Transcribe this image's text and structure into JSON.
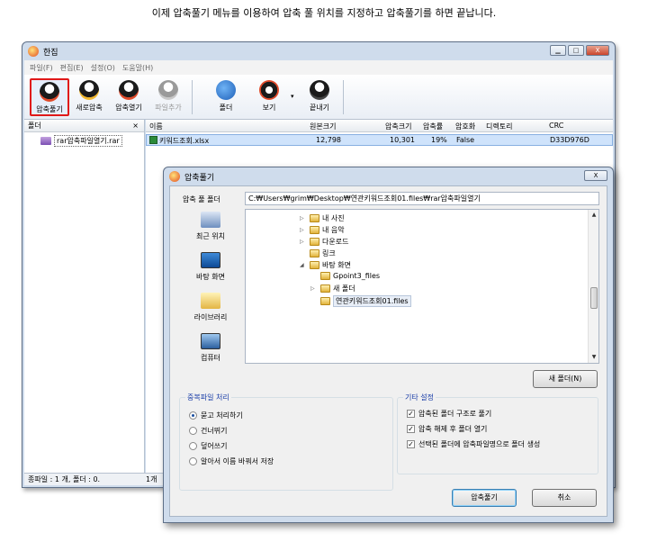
{
  "caption": "이제 압축풀기 메뉴를 이용하여  압축 풀 위치를 지정하고 압축풀기를 하면 끝납니다.",
  "main_window": {
    "title": "한집",
    "controls": {
      "minimize": "▁",
      "maximize": "□",
      "close": "X"
    },
    "menu": [
      "파일(F)",
      "편집(E)",
      "설정(O)",
      "도움말(H)"
    ],
    "toolbar": [
      {
        "label": "압축풀기",
        "icon": "penguin-extract-icon",
        "state": "selected"
      },
      {
        "label": "새로압축",
        "icon": "penguin-new-icon"
      },
      {
        "label": "압축열기",
        "icon": "penguin-open-icon"
      },
      {
        "label": "파일추가",
        "icon": "penguin-add-icon",
        "state": "disabled"
      },
      {
        "label": "폴더",
        "icon": "globe-folder-icon"
      },
      {
        "label": "보기",
        "icon": "eye-view-icon"
      },
      {
        "label": "끝내기",
        "icon": "exit-icon"
      }
    ],
    "left_pane": {
      "header": "폴더",
      "close": "×",
      "tree_item": "rar압축파일열기.rar"
    },
    "file_list": {
      "columns": [
        "이름",
        "원본크기",
        "압축크기",
        "압축률",
        "암호화",
        "디렉토리",
        "CRC"
      ],
      "rows": [
        {
          "name": "키워드조회.xlsx",
          "original_size": "12,798",
          "compressed_size": "10,301",
          "ratio": "19%",
          "encrypted": "False",
          "directory": "",
          "crc": "D33D976D"
        }
      ]
    },
    "status": {
      "left": "종파일 : 1 개, 폴더 : 0.",
      "right": "1개"
    }
  },
  "dialog": {
    "title": "압축풀기",
    "close": "X",
    "path_label": "압축 풀 폴더",
    "path_value": "C:₩Users₩grim₩Desktop₩연관키워드조회01.files₩rar압축파일열기",
    "places": [
      {
        "label": "최근 위치",
        "icon": "recent-places-icon"
      },
      {
        "label": "바탕 화면",
        "icon": "desktop-icon"
      },
      {
        "label": "라이브러리",
        "icon": "library-icon"
      },
      {
        "label": "컴퓨터",
        "icon": "computer-icon"
      }
    ],
    "tree": [
      {
        "label": "내 사진",
        "arrow": "▷"
      },
      {
        "label": "내 음악",
        "arrow": "▷"
      },
      {
        "label": "다운로드",
        "arrow": "▷"
      },
      {
        "label": "링크",
        "arrow": ""
      },
      {
        "label": "바탕 화면",
        "arrow": "◢"
      },
      {
        "label": "Gpoint3_files",
        "arrow": ""
      },
      {
        "label": "새 폴더",
        "arrow": "▷"
      },
      {
        "label": "연관키워드조회01.files",
        "arrow": "",
        "selected": true
      }
    ],
    "scroll": {
      "up": "▲",
      "down": "▼"
    },
    "new_folder_button": "새 폴더(N)",
    "duplicate_group": {
      "title": "중복파일 처리",
      "options": [
        {
          "label": "묻고 처리하기",
          "checked": true
        },
        {
          "label": "건너뛰기",
          "checked": false
        },
        {
          "label": "덮어쓰기",
          "checked": false
        },
        {
          "label": "알아서 이름 바꿔서 저장",
          "checked": false
        }
      ]
    },
    "other_group": {
      "title": "기타 설정",
      "options": [
        {
          "label": "압축된 폴더 구조로 풀기",
          "checked": true
        },
        {
          "label": "압축 해제 후 폴더 열기",
          "checked": true
        },
        {
          "label": "선택된 폴더에 압축파일명으로 폴더 생성",
          "checked": true
        }
      ]
    },
    "ok_button": "압축풀기",
    "cancel_button": "취소"
  }
}
